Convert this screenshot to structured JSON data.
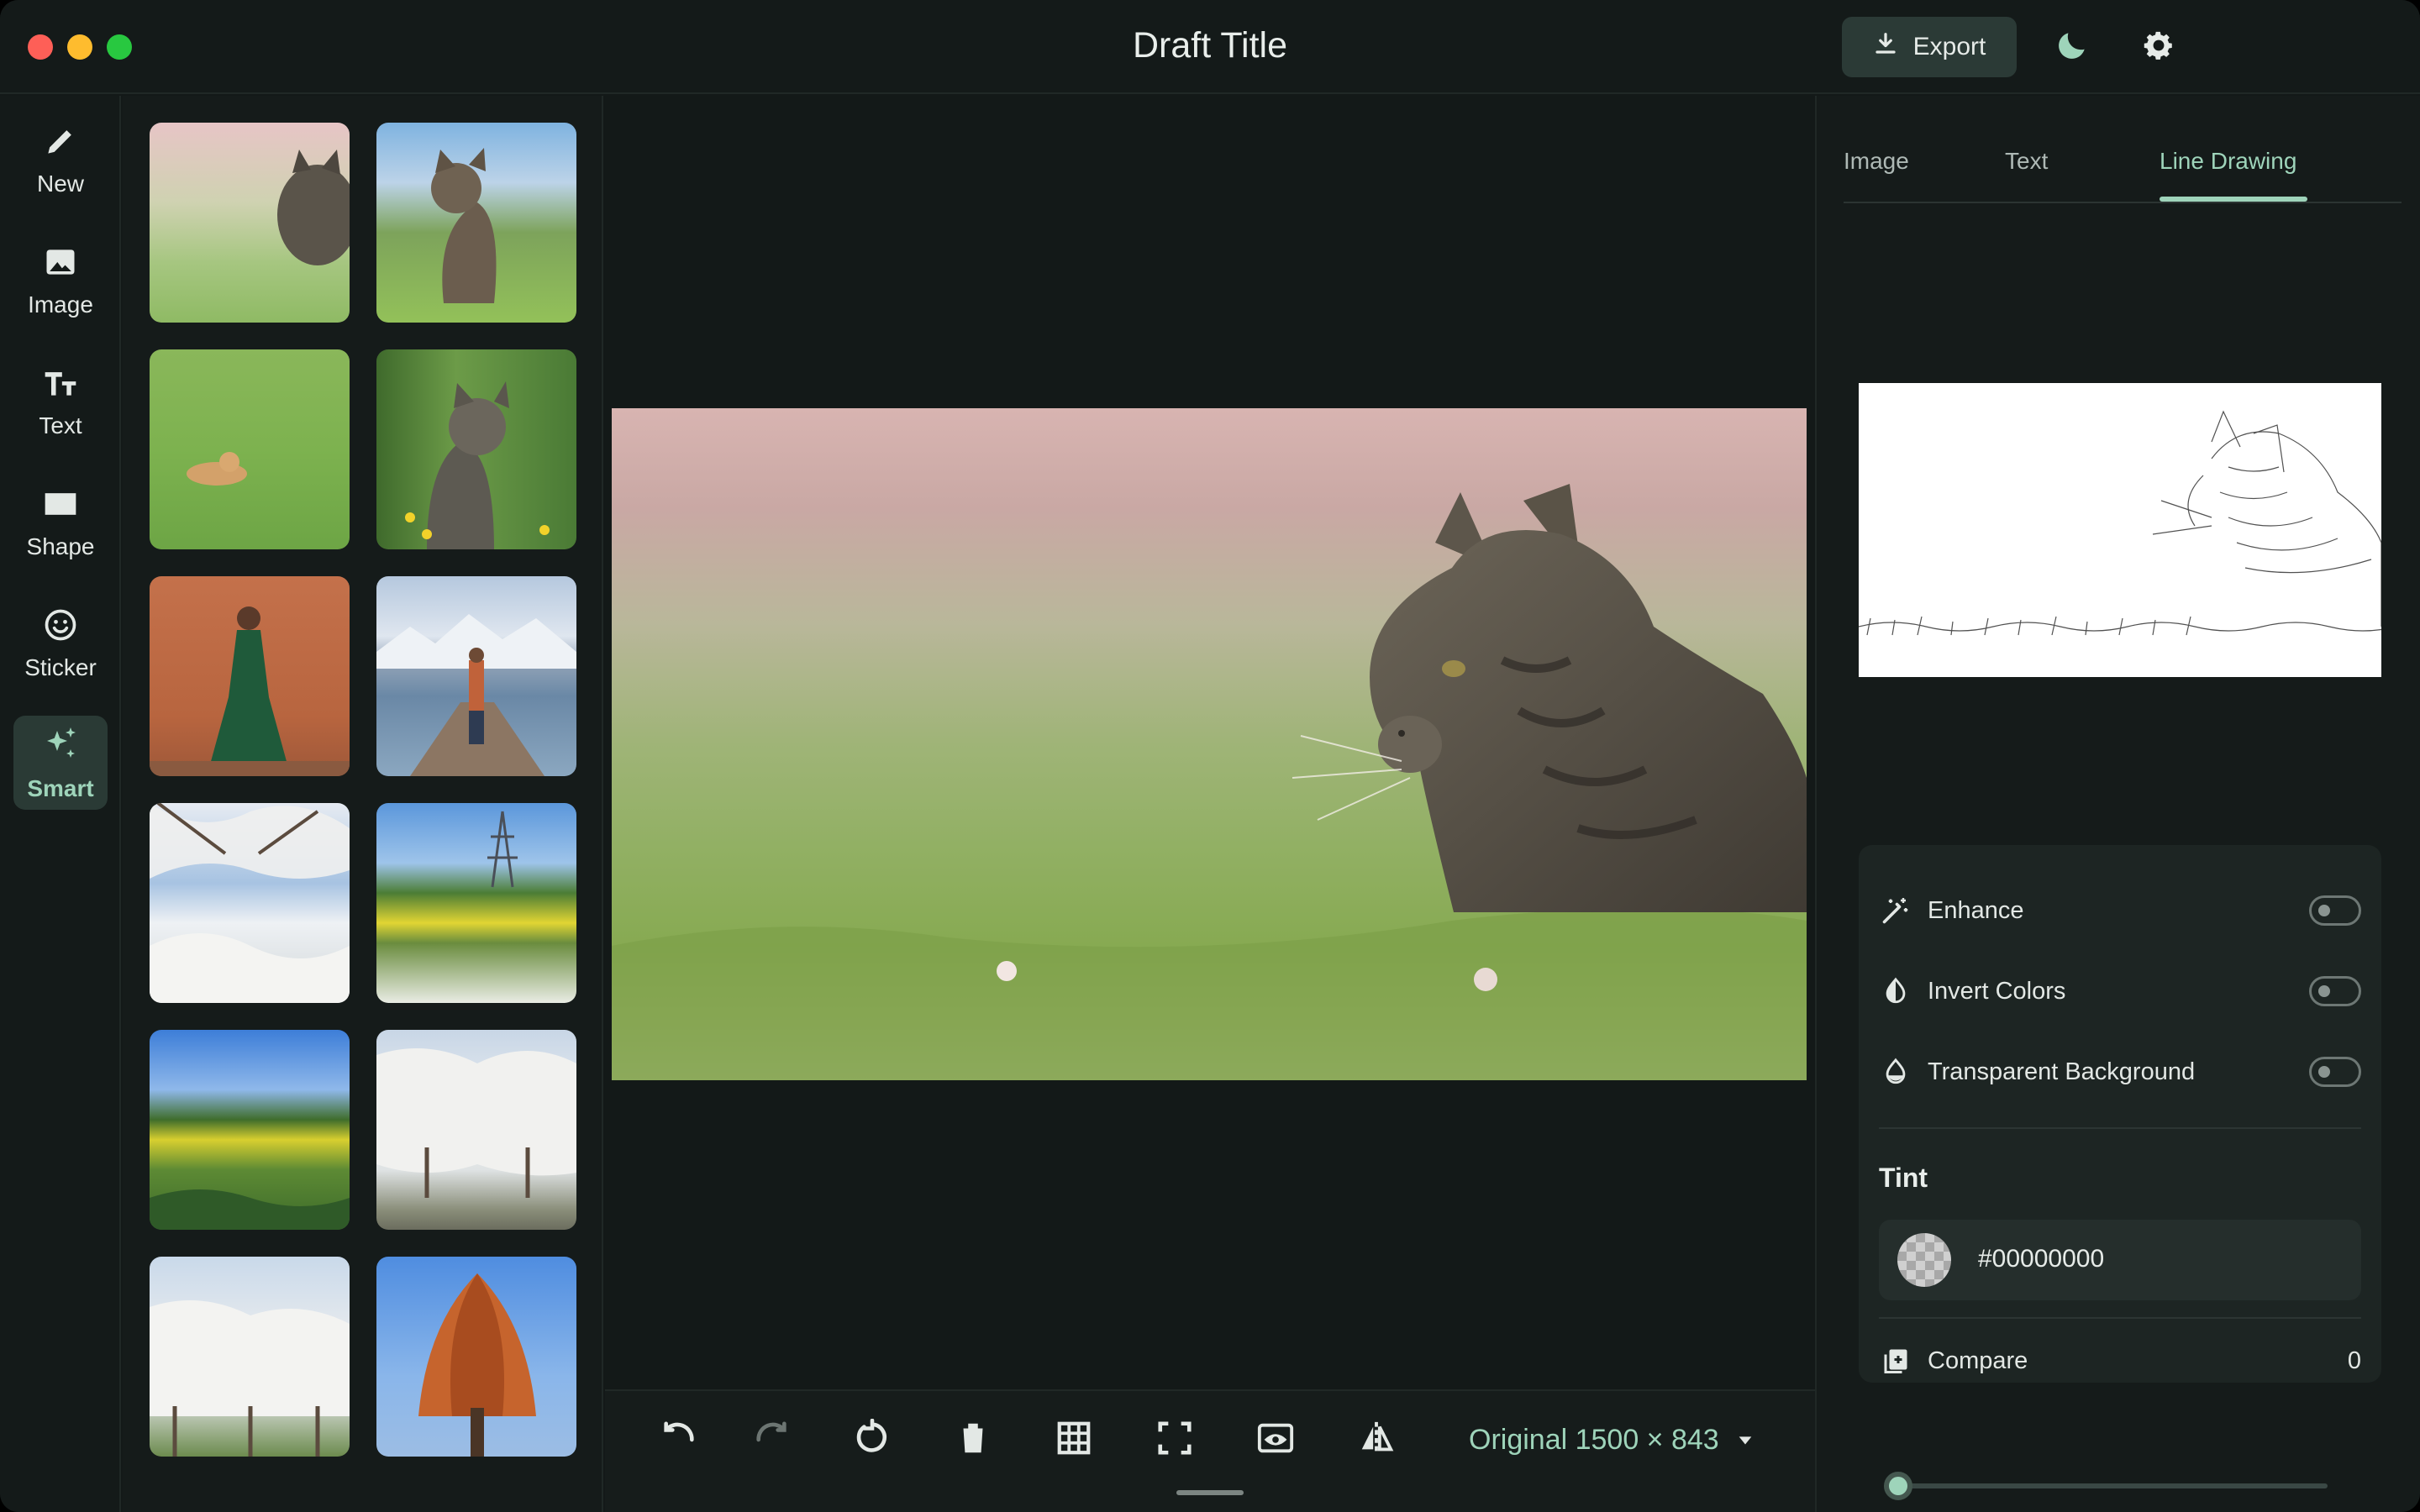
{
  "window": {
    "title": "Draft Title"
  },
  "toolbar": {
    "export_label": "Export",
    "export_icon": "download-icon",
    "theme_icon": "moon-icon",
    "settings_icon": "gear-icon"
  },
  "rail": {
    "items": [
      {
        "label": "New",
        "icon": "pencil-icon"
      },
      {
        "label": "Image",
        "icon": "image-icon"
      },
      {
        "label": "Text",
        "icon": "text-size-icon"
      },
      {
        "label": "Shape",
        "icon": "rectangle-icon"
      },
      {
        "label": "Sticker",
        "icon": "smiley-icon"
      },
      {
        "label": "Smart",
        "icon": "sparkles-icon",
        "active": true
      }
    ]
  },
  "gallery": {
    "thumbnails": [
      "cat in grass, pink bokeh",
      "tabby cat sitting in meadow",
      "kitten lying in green grass",
      "tabby cat among tall grass and yellow flowers",
      "woman in green dress, orange wall",
      "person on pier by mountain lake",
      "white blossom trees and sky",
      "yellow flower field and power tower",
      "green field with trees under blue sky",
      "white blossom tree park",
      "blossom trees row",
      "orange autumn tree against blue sky"
    ]
  },
  "bottom_bar": {
    "tools": [
      "undo-icon",
      "redo-icon",
      "rotate-icon",
      "trash-icon",
      "grid-icon",
      "fullscreen-icon",
      "preview-eye-icon",
      "flip-icon"
    ],
    "size_label": "Original 1500 × 843"
  },
  "right_panel": {
    "tabs": [
      {
        "label": "Image"
      },
      {
        "label": "Text"
      },
      {
        "label": "Line Drawing",
        "active": true
      }
    ],
    "options": [
      {
        "label": "Enhance",
        "icon": "magic-wand-icon",
        "enabled": false
      },
      {
        "label": "Invert Colors",
        "icon": "contrast-drop-icon",
        "enabled": false
      },
      {
        "label": "Transparent Background",
        "icon": "drop-icon",
        "enabled": false
      }
    ],
    "tint": {
      "label": "Tint",
      "value": "#00000000"
    },
    "compare": {
      "label": "Compare",
      "value": "0",
      "icon": "compare-doc-icon"
    }
  },
  "colors": {
    "accent": "#9ed4ba",
    "background": "#131918",
    "panel": "#1d2523"
  }
}
